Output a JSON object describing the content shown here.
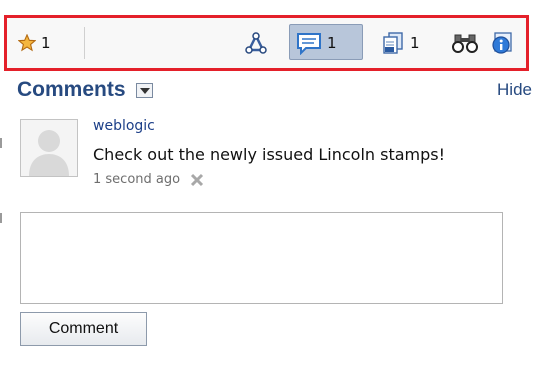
{
  "toolbar": {
    "rating_icon": "star-icon",
    "rating_count": "1",
    "links_icon": "network-links-icon",
    "comments_icon": "comment-bubble-icon",
    "comments_count": "1",
    "versions_icon": "document-versions-icon",
    "versions_count": "1",
    "watch_icon": "binoculars-icon",
    "info_icon": "info-icon",
    "border_color": "#e4202a",
    "active_bg": "#b8c6da"
  },
  "comments": {
    "title": "Comments",
    "hide_label": "Hide",
    "items": [
      {
        "author": "weblogic",
        "text": "Check out the newly issued Lincoln stamps!",
        "time": "1 second ago",
        "avatar_icon": "user-silhouette-icon",
        "delete_icon": "delete-icon"
      }
    ],
    "input_value": "",
    "submit_label": "Comment"
  },
  "colors": {
    "link": "#274a80",
    "accent_red": "#e4202a"
  }
}
